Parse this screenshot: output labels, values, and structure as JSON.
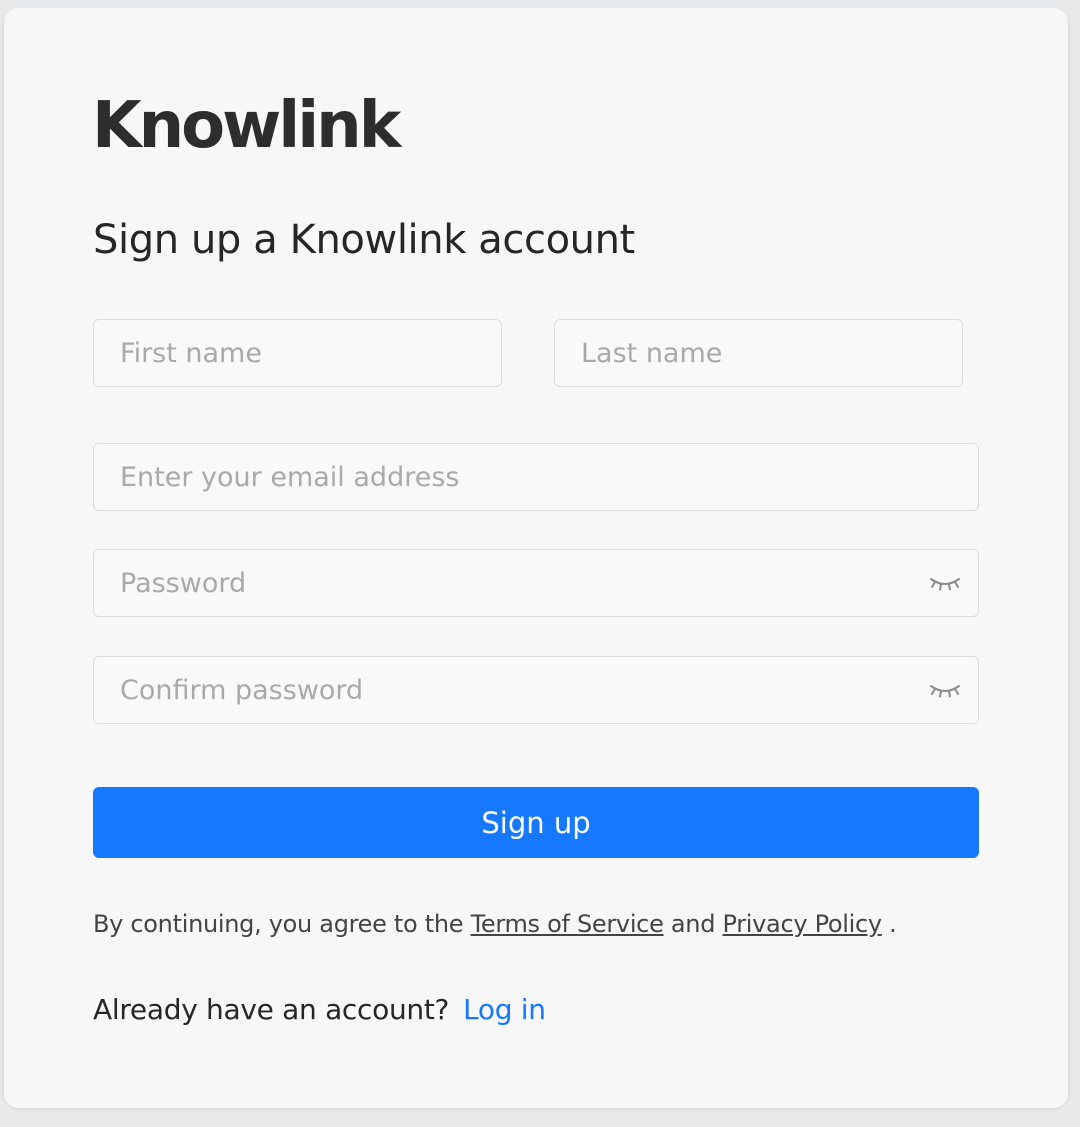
{
  "brand": {
    "logo_text": "Knowlink"
  },
  "form": {
    "heading": "Sign up a Knowlink account",
    "first_name": {
      "placeholder": "First name",
      "value": ""
    },
    "last_name": {
      "placeholder": "Last name",
      "value": ""
    },
    "email": {
      "placeholder": "Enter your email address",
      "value": ""
    },
    "password": {
      "placeholder": "Password",
      "value": "",
      "toggle_icon": "eye-closed-icon"
    },
    "confirm_password": {
      "placeholder": "Confirm password",
      "value": "",
      "toggle_icon": "eye-closed-icon"
    },
    "submit_label": "Sign up"
  },
  "legal": {
    "prefix": "By continuing, you agree to the ",
    "terms_link": "Terms of Service",
    "middle": " and ",
    "privacy_link": "Privacy Policy",
    "suffix": " ."
  },
  "footer": {
    "prompt": "Already have an account?",
    "login_link": "Log in"
  },
  "colors": {
    "primary": "#1677ff",
    "text": "#262626",
    "placeholder": "#a9a9a9",
    "border": "#dcdcdc",
    "card_bg": "#f7f7f7",
    "page_bg": "#e7e8ea"
  }
}
